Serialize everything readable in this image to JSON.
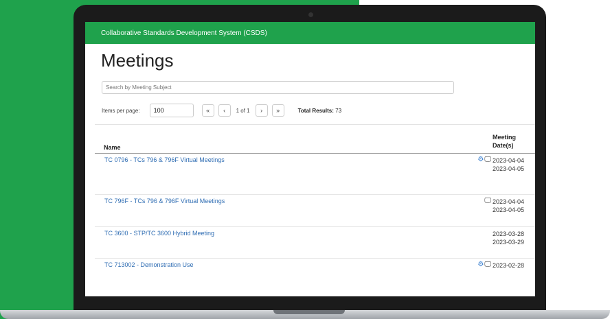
{
  "app": {
    "title": "Collaborative Standards Development System (CSDS)"
  },
  "page": {
    "title": "Meetings"
  },
  "search": {
    "placeholder": "Search by Meeting Subject",
    "value": ""
  },
  "pagination": {
    "items_per_page_label": "Items per page:",
    "items_per_page_value": "100",
    "first": "«",
    "prev": "‹",
    "page_info": "1 of 1",
    "next": "›",
    "last": "»",
    "total_label": "Total Results:",
    "total_value": "73"
  },
  "table": {
    "columns": {
      "name": "Name",
      "date_line1": "Meeting",
      "date_line2": "Date(s)"
    },
    "rows": [
      {
        "name": "TC 0796 - TCs 796 & 796F Virtual Meetings",
        "icons": [
          "gears-icon",
          "monitor-icon"
        ],
        "dates": [
          "2023-04-04",
          "2023-04-05"
        ]
      },
      {
        "name": "TC 796F - TCs 796 & 796F Virtual Meetings",
        "icons": [
          "monitor-icon"
        ],
        "dates": [
          "2023-04-04",
          "2023-04-05"
        ]
      },
      {
        "name": "TC 3600 - STP/TC 3600 Hybrid Meeting",
        "icons": [],
        "dates": [
          "2023-03-28",
          "2023-03-29"
        ]
      },
      {
        "name": "TC 713002 - Demonstration Use",
        "icons": [
          "gears-icon",
          "monitor-icon"
        ],
        "dates": [
          "2023-02-28"
        ]
      }
    ]
  },
  "colors": {
    "brand_green": "#1fa24c",
    "link_blue": "#2f6db3",
    "icon_blue": "#3a7fcf"
  }
}
